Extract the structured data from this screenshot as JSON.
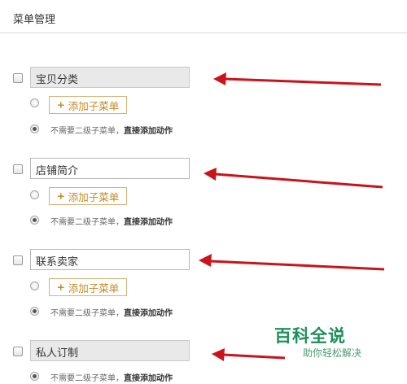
{
  "title": "菜单管理",
  "menu_items": [
    {
      "name": "宝贝分类",
      "add_label": "添加子菜单",
      "opt_text": "不需要二级子菜单，",
      "opt_link": "直接添加动作"
    },
    {
      "name": "店铺简介",
      "add_label": "添加子菜单",
      "opt_text": "不需要二级子菜单，",
      "opt_link": "直接添加动作"
    },
    {
      "name": "联系卖家",
      "add_label": "添加子菜单",
      "opt_text": "不需要二级子菜单，",
      "opt_link": "直接添加动作"
    },
    {
      "name": "私人订制",
      "opt_text": "不需要二级子菜单，",
      "opt_link": "直接添加动作"
    }
  ],
  "icons": {
    "plus": "+",
    "arrow": "red-arrow-icon"
  },
  "colors": {
    "arrow": "#c8141a",
    "add_button": "#c28a24",
    "watermark": "#1e8f5a"
  },
  "watermark": {
    "title": "百科全说",
    "subtitle": "助你轻松解决"
  }
}
